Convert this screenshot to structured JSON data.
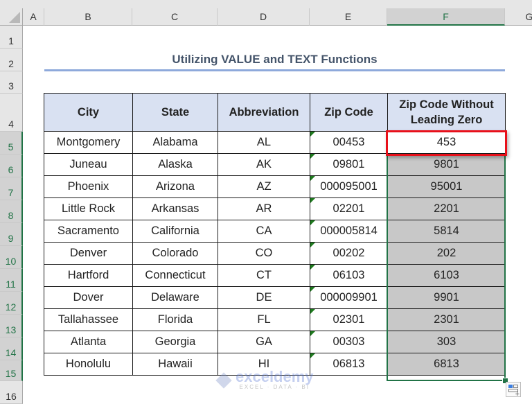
{
  "sheet": {
    "columns": [
      "A",
      "B",
      "C",
      "D",
      "E",
      "F",
      "G"
    ],
    "selected_column": "F",
    "rows": [
      "1",
      "2",
      "3",
      "4",
      "5",
      "6",
      "7",
      "8",
      "9",
      "10",
      "11",
      "12",
      "13",
      "14",
      "15",
      "16"
    ],
    "selected_rows": [
      "5",
      "6",
      "7",
      "8",
      "9",
      "10",
      "11",
      "12",
      "13",
      "14",
      "15"
    ]
  },
  "title": "Utilizing VALUE and TEXT Functions",
  "table": {
    "headers": [
      "City",
      "State",
      "Abbreviation",
      "Zip Code",
      "Zip Code Without Leading Zero"
    ],
    "rows": [
      {
        "city": "Montgomery",
        "state": "Alabama",
        "abbr": "AL",
        "zip": "00453",
        "result": "453"
      },
      {
        "city": "Juneau",
        "state": "Alaska",
        "abbr": "AK",
        "zip": "09801",
        "result": "9801"
      },
      {
        "city": "Phoenix",
        "state": "Arizona",
        "abbr": "AZ",
        "zip": "000095001",
        "result": "95001"
      },
      {
        "city": "Little Rock",
        "state": "Arkansas",
        "abbr": "AR",
        "zip": "02201",
        "result": "2201"
      },
      {
        "city": "Sacramento",
        "state": "California",
        "abbr": "CA",
        "zip": "000005814",
        "result": "5814"
      },
      {
        "city": "Denver",
        "state": "Colorado",
        "abbr": "CO",
        "zip": "00202",
        "result": "202"
      },
      {
        "city": "Hartford",
        "state": "Connecticut",
        "abbr": "CT",
        "zip": "06103",
        "result": "6103"
      },
      {
        "city": "Dover",
        "state": "Delaware",
        "abbr": "DE",
        "zip": "000009901",
        "result": "9901"
      },
      {
        "city": "Tallahassee",
        "state": "Florida",
        "abbr": "FL",
        "zip": "02301",
        "result": "2301"
      },
      {
        "city": "Atlanta",
        "state": "Georgia",
        "abbr": "GA",
        "zip": "00303",
        "result": "303"
      },
      {
        "city": "Honolulu",
        "state": "Hawaii",
        "abbr": "HI",
        "zip": "06813",
        "result": "6813"
      }
    ]
  },
  "watermark": {
    "name": "exceldemy",
    "tagline": "EXCEL · DATA · BI"
  },
  "icons": {
    "quick_analysis": "quick-analysis-icon",
    "error_indicator": "green-triangle-icon"
  },
  "colors": {
    "header_fill": "#d9e1f2",
    "selection": "#217346",
    "highlight_box": "#e8101a",
    "title": "#44546a"
  }
}
